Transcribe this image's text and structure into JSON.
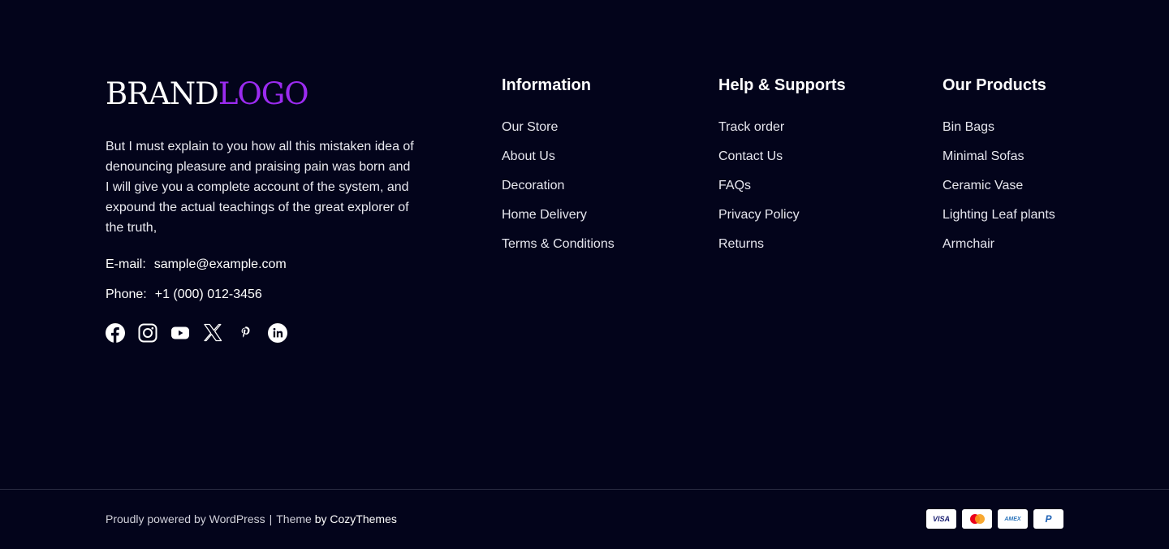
{
  "brand": {
    "part1": "BRAND",
    "part2": "LOGO",
    "accent_color": "#9b2bf0"
  },
  "about": {
    "text": "But I must explain to you how all this mistaken idea of denouncing pleasure and praising pain was born and I will give you a complete account of the system, and expound the actual teachings of the great explorer of the truth,"
  },
  "contact": {
    "email_label": "E-mail:",
    "email": "sample@example.com",
    "phone_label": "Phone:",
    "phone": "+1 (000) 012-3456"
  },
  "socials": [
    "facebook-icon",
    "instagram-icon",
    "youtube-icon",
    "x-icon",
    "pinterest-icon",
    "linkedin-icon"
  ],
  "columns": [
    {
      "title": "Information",
      "items": [
        "Our Store",
        "About Us",
        "Decoration",
        "Home Delivery",
        "Terms & Conditions"
      ]
    },
    {
      "title": "Help & Supports",
      "items": [
        "Track order",
        "Contact Us",
        "FAQs",
        "Privacy Policy",
        "Returns"
      ]
    },
    {
      "title": "Our Products",
      "items": [
        "Bin Bags",
        "Minimal Sofas",
        "Ceramic Vase",
        "Lighting Leaf plants",
        "Armchair"
      ]
    }
  ],
  "footer_bottom": {
    "powered": "Proudly powered by WordPress",
    "separator": "|",
    "theme": "Theme",
    "by": "by CozyThemes"
  },
  "payments": [
    {
      "icon": "visa-icon",
      "label": "VISA"
    },
    {
      "icon": "mastercard-icon",
      "label": ""
    },
    {
      "icon": "amex-icon",
      "label": "AMEX"
    },
    {
      "icon": "paypal-icon",
      "label": "P"
    }
  ],
  "colors": {
    "background": "#03041b",
    "text": "#ffffff"
  }
}
